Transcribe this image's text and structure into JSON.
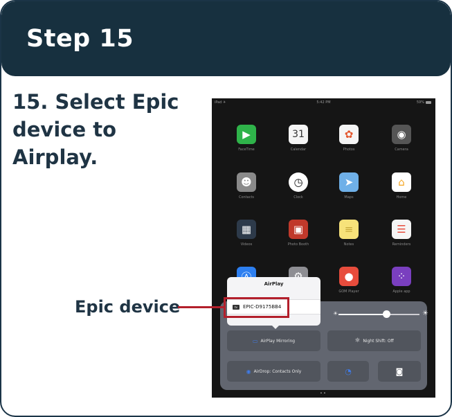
{
  "header": {
    "title": "Step 15"
  },
  "instruction": "15. Select Epic device to Airplay.",
  "callout": {
    "label": "Epic device",
    "color": "#b31f2b"
  },
  "ipad": {
    "status": {
      "left": "iPad ✈",
      "time": "5:42 PM",
      "battery": "59%"
    },
    "apps": [
      {
        "label": "FaceTime",
        "icon": "facetime-icon",
        "color": "#2fb34a"
      },
      {
        "label": "Calendar",
        "icon": "calendar-icon",
        "color": "#f5f5f5",
        "glyph": "31"
      },
      {
        "label": "Photos",
        "icon": "photos-icon",
        "color": "#f5f5f5"
      },
      {
        "label": "Camera",
        "icon": "camera-icon",
        "color": "#555555"
      },
      {
        "label": "Contacts",
        "icon": "contacts-icon",
        "color": "#8a8a8a"
      },
      {
        "label": "Clock",
        "icon": "clock-icon",
        "color": "#ffffff"
      },
      {
        "label": "Maps",
        "icon": "maps-icon",
        "color": "#6fb0e8"
      },
      {
        "label": "Home",
        "icon": "home-icon",
        "color": "#f5a623"
      },
      {
        "label": "Videos",
        "icon": "videos-icon",
        "color": "#2d3a4a"
      },
      {
        "label": "Photo Booth",
        "icon": "photo-booth-icon",
        "color": "#c0392b"
      },
      {
        "label": "Notes",
        "icon": "notes-icon",
        "color": "#f7e27a"
      },
      {
        "label": "Reminders",
        "icon": "reminders-icon",
        "color": "#f5f5f5"
      },
      {
        "label": "",
        "icon": "app-store-icon",
        "color": "#2d7ff0"
      },
      {
        "label": "",
        "icon": "settings-icon",
        "color": "#8e8e93"
      },
      {
        "label": "GOM Player",
        "icon": "gom-player-icon",
        "color": "#e74c3c"
      },
      {
        "label": "Apple app",
        "icon": "apple-app-icon",
        "color": "#7a3fbf"
      }
    ],
    "airplay_popup": {
      "title": "AirPlay",
      "device": "EPIC-D9175BB4"
    },
    "control_center": {
      "airplay_mirroring": "AirPlay Mirroring",
      "night_shift": "Night Shift: Off",
      "airdrop": "AirDrop: Contacts Only",
      "brightness_level": 0.59
    }
  }
}
